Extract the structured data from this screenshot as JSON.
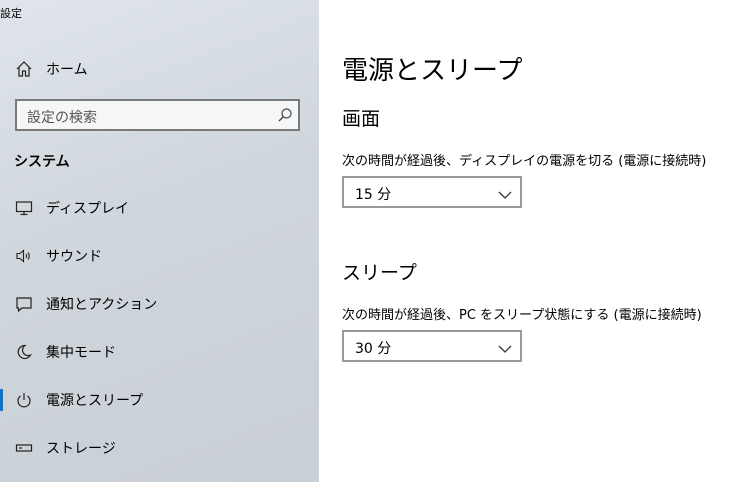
{
  "window": {
    "title": "設定"
  },
  "sidebar": {
    "home_label": "ホーム",
    "search_placeholder": "設定の検索",
    "section_title": "システム",
    "items": [
      {
        "label": "ディスプレイ",
        "icon": "monitor-icon"
      },
      {
        "label": "サウンド",
        "icon": "speaker-icon"
      },
      {
        "label": "通知とアクション",
        "icon": "notification-icon"
      },
      {
        "label": "集中モード",
        "icon": "moon-icon"
      },
      {
        "label": "電源とスリープ",
        "icon": "power-icon",
        "selected": true
      },
      {
        "label": "ストレージ",
        "icon": "storage-icon"
      }
    ],
    "accent_color": "#0078d7"
  },
  "main": {
    "title": "電源とスリープ",
    "screen": {
      "heading": "画面",
      "description": "次の時間が経過後、ディスプレイの電源を切る (電源に接続時)",
      "selected": "15 分"
    },
    "sleep": {
      "heading": "スリープ",
      "description": "次の時間が経過後、PC をスリープ状態にする (電源に接続時)",
      "selected": "30 分"
    }
  }
}
